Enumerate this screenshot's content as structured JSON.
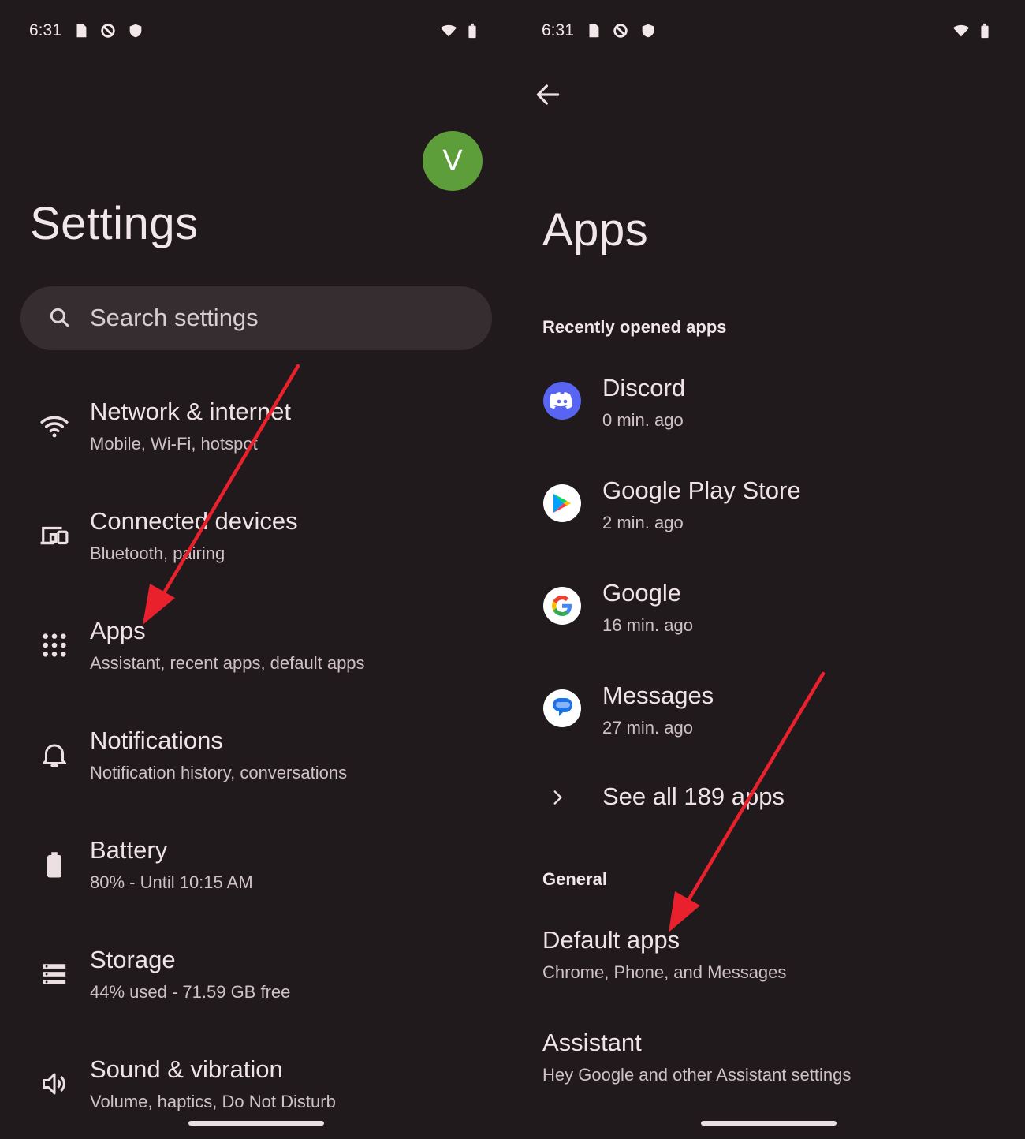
{
  "colors": {
    "background": "#201a1c",
    "avatar": "#5e9e3a",
    "search_bg": "#352d30",
    "arrow": "#e8212c"
  },
  "status_bar": {
    "time": "6:31"
  },
  "settings": {
    "avatar_initial": "V",
    "title": "Settings",
    "search_placeholder": "Search settings",
    "items": [
      {
        "icon": "wifi-icon",
        "title": "Network & internet",
        "subtitle": "Mobile, Wi-Fi, hotspot"
      },
      {
        "icon": "connected-devices-icon",
        "title": "Connected devices",
        "subtitle": "Bluetooth, pairing"
      },
      {
        "icon": "apps-grid-icon",
        "title": "Apps",
        "subtitle": "Assistant, recent apps, default apps"
      },
      {
        "icon": "bell-icon",
        "title": "Notifications",
        "subtitle": "Notification history, conversations"
      },
      {
        "icon": "battery-icon",
        "title": "Battery",
        "subtitle": "80% - Until 10:15 AM"
      },
      {
        "icon": "storage-icon",
        "title": "Storage",
        "subtitle": "44% used - 71.59 GB free"
      },
      {
        "icon": "speaker-icon",
        "title": "Sound & vibration",
        "subtitle": "Volume, haptics, Do Not Disturb"
      }
    ]
  },
  "apps": {
    "title": "Apps",
    "recent_header": "Recently opened apps",
    "recent": [
      {
        "icon": "discord-icon",
        "name": "Discord",
        "time": "0 min. ago"
      },
      {
        "icon": "google-play-store-icon",
        "name": "Google Play Store",
        "time": "2 min. ago"
      },
      {
        "icon": "google-icon",
        "name": "Google",
        "time": "16 min. ago"
      },
      {
        "icon": "messages-icon",
        "name": "Messages",
        "time": "27 min. ago"
      }
    ],
    "see_all": "See all 189 apps",
    "general_header": "General",
    "general": [
      {
        "title": "Default apps",
        "subtitle": "Chrome, Phone, and Messages"
      },
      {
        "title": "Assistant",
        "subtitle": "Hey Google and other Assistant settings"
      }
    ]
  }
}
